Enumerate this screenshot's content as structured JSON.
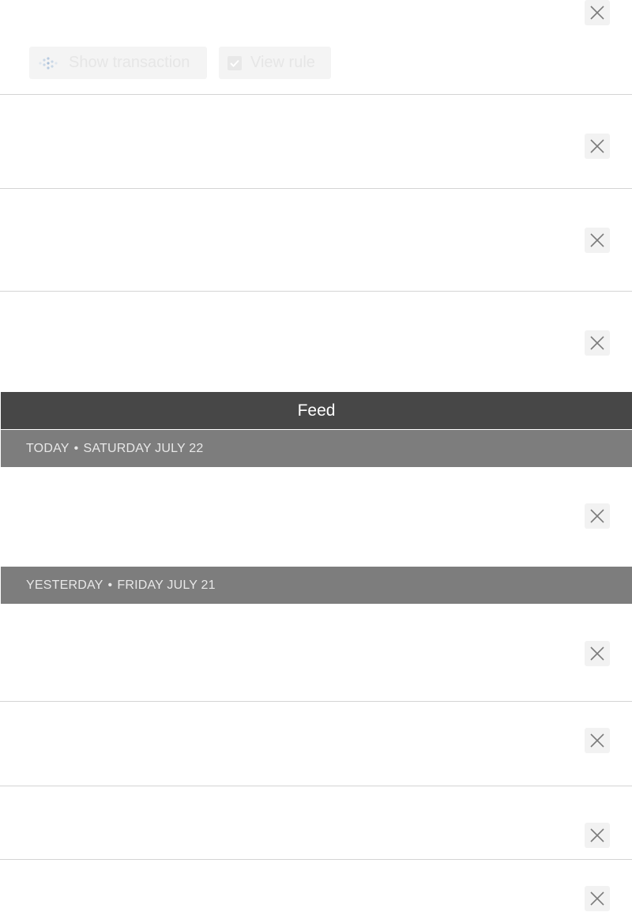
{
  "notification_actions": {
    "show_transaction_label": "Show transaction",
    "view_rule_label": "View rule"
  },
  "feed": {
    "title": "Feed"
  },
  "sections": {
    "today": {
      "label": "TODAY",
      "separator": "•",
      "date": "SATURDAY JULY 22"
    },
    "yesterday": {
      "label": "YESTERDAY",
      "separator": "•",
      "date": "FRIDAY JULY 21"
    }
  },
  "icons": {
    "close": "close-icon",
    "transaction": "transaction-dots-icon",
    "checkbox": "checkbox-checked-icon"
  },
  "colors": {
    "feed_bar": "#474747",
    "date_header": "#7d7d7d",
    "close_bg": "#f2f2f2",
    "divider": "#d4d4d4"
  }
}
